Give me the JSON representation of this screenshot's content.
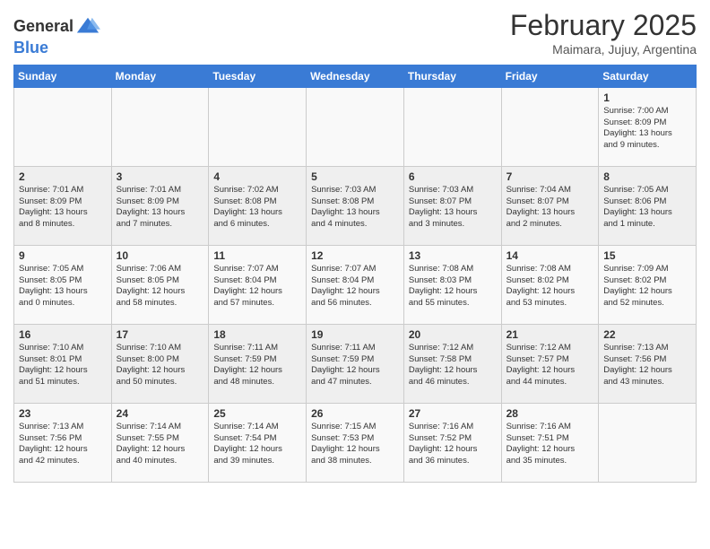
{
  "logo": {
    "general": "General",
    "blue": "Blue"
  },
  "header": {
    "month": "February 2025",
    "location": "Maimara, Jujuy, Argentina"
  },
  "weekdays": [
    "Sunday",
    "Monday",
    "Tuesday",
    "Wednesday",
    "Thursday",
    "Friday",
    "Saturday"
  ],
  "weeks": [
    [
      {
        "day": "",
        "info": ""
      },
      {
        "day": "",
        "info": ""
      },
      {
        "day": "",
        "info": ""
      },
      {
        "day": "",
        "info": ""
      },
      {
        "day": "",
        "info": ""
      },
      {
        "day": "",
        "info": ""
      },
      {
        "day": "1",
        "info": "Sunrise: 7:00 AM\nSunset: 8:09 PM\nDaylight: 13 hours\nand 9 minutes."
      }
    ],
    [
      {
        "day": "2",
        "info": "Sunrise: 7:01 AM\nSunset: 8:09 PM\nDaylight: 13 hours\nand 8 minutes."
      },
      {
        "day": "3",
        "info": "Sunrise: 7:01 AM\nSunset: 8:09 PM\nDaylight: 13 hours\nand 7 minutes."
      },
      {
        "day": "4",
        "info": "Sunrise: 7:02 AM\nSunset: 8:08 PM\nDaylight: 13 hours\nand 6 minutes."
      },
      {
        "day": "5",
        "info": "Sunrise: 7:03 AM\nSunset: 8:08 PM\nDaylight: 13 hours\nand 4 minutes."
      },
      {
        "day": "6",
        "info": "Sunrise: 7:03 AM\nSunset: 8:07 PM\nDaylight: 13 hours\nand 3 minutes."
      },
      {
        "day": "7",
        "info": "Sunrise: 7:04 AM\nSunset: 8:07 PM\nDaylight: 13 hours\nand 2 minutes."
      },
      {
        "day": "8",
        "info": "Sunrise: 7:05 AM\nSunset: 8:06 PM\nDaylight: 13 hours\nand 1 minute."
      }
    ],
    [
      {
        "day": "9",
        "info": "Sunrise: 7:05 AM\nSunset: 8:05 PM\nDaylight: 13 hours\nand 0 minutes."
      },
      {
        "day": "10",
        "info": "Sunrise: 7:06 AM\nSunset: 8:05 PM\nDaylight: 12 hours\nand 58 minutes."
      },
      {
        "day": "11",
        "info": "Sunrise: 7:07 AM\nSunset: 8:04 PM\nDaylight: 12 hours\nand 57 minutes."
      },
      {
        "day": "12",
        "info": "Sunrise: 7:07 AM\nSunset: 8:04 PM\nDaylight: 12 hours\nand 56 minutes."
      },
      {
        "day": "13",
        "info": "Sunrise: 7:08 AM\nSunset: 8:03 PM\nDaylight: 12 hours\nand 55 minutes."
      },
      {
        "day": "14",
        "info": "Sunrise: 7:08 AM\nSunset: 8:02 PM\nDaylight: 12 hours\nand 53 minutes."
      },
      {
        "day": "15",
        "info": "Sunrise: 7:09 AM\nSunset: 8:02 PM\nDaylight: 12 hours\nand 52 minutes."
      }
    ],
    [
      {
        "day": "16",
        "info": "Sunrise: 7:10 AM\nSunset: 8:01 PM\nDaylight: 12 hours\nand 51 minutes."
      },
      {
        "day": "17",
        "info": "Sunrise: 7:10 AM\nSunset: 8:00 PM\nDaylight: 12 hours\nand 50 minutes."
      },
      {
        "day": "18",
        "info": "Sunrise: 7:11 AM\nSunset: 7:59 PM\nDaylight: 12 hours\nand 48 minutes."
      },
      {
        "day": "19",
        "info": "Sunrise: 7:11 AM\nSunset: 7:59 PM\nDaylight: 12 hours\nand 47 minutes."
      },
      {
        "day": "20",
        "info": "Sunrise: 7:12 AM\nSunset: 7:58 PM\nDaylight: 12 hours\nand 46 minutes."
      },
      {
        "day": "21",
        "info": "Sunrise: 7:12 AM\nSunset: 7:57 PM\nDaylight: 12 hours\nand 44 minutes."
      },
      {
        "day": "22",
        "info": "Sunrise: 7:13 AM\nSunset: 7:56 PM\nDaylight: 12 hours\nand 43 minutes."
      }
    ],
    [
      {
        "day": "23",
        "info": "Sunrise: 7:13 AM\nSunset: 7:56 PM\nDaylight: 12 hours\nand 42 minutes."
      },
      {
        "day": "24",
        "info": "Sunrise: 7:14 AM\nSunset: 7:55 PM\nDaylight: 12 hours\nand 40 minutes."
      },
      {
        "day": "25",
        "info": "Sunrise: 7:14 AM\nSunset: 7:54 PM\nDaylight: 12 hours\nand 39 minutes."
      },
      {
        "day": "26",
        "info": "Sunrise: 7:15 AM\nSunset: 7:53 PM\nDaylight: 12 hours\nand 38 minutes."
      },
      {
        "day": "27",
        "info": "Sunrise: 7:16 AM\nSunset: 7:52 PM\nDaylight: 12 hours\nand 36 minutes."
      },
      {
        "day": "28",
        "info": "Sunrise: 7:16 AM\nSunset: 7:51 PM\nDaylight: 12 hours\nand 35 minutes."
      },
      {
        "day": "",
        "info": ""
      }
    ]
  ]
}
